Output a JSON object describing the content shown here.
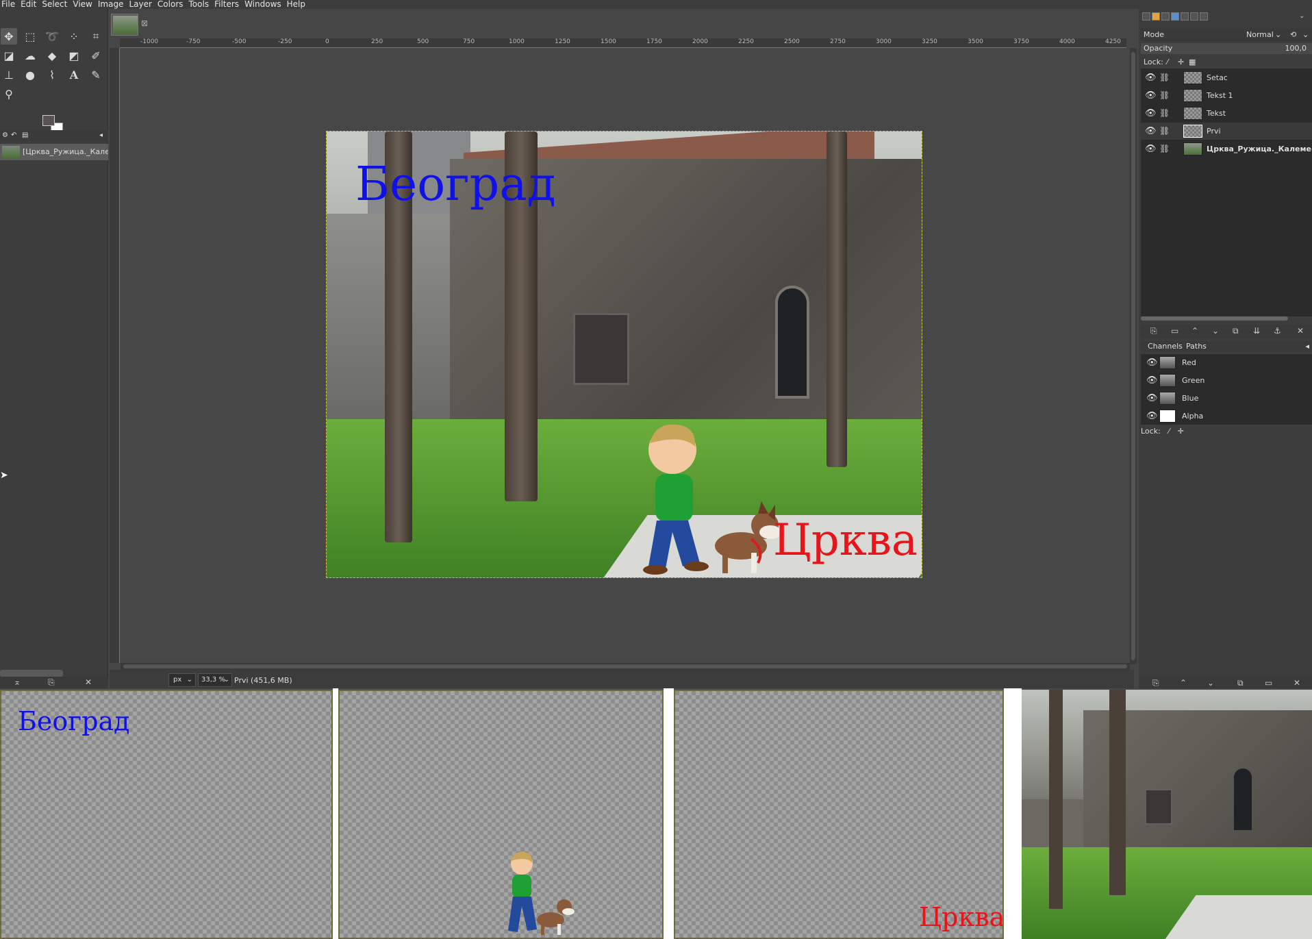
{
  "menu": [
    "File",
    "Edit",
    "Select",
    "View",
    "Image",
    "Layer",
    "Colors",
    "Tools",
    "Filters",
    "Windows",
    "Help"
  ],
  "colors": {
    "foreground": "#5b5353",
    "background": "#ffffff",
    "text_blue": "#1010e8",
    "text_red": "#e8141a"
  },
  "tools": [
    "move-icon",
    "rect-select-icon",
    "lasso-icon",
    "fuzzy-select-icon",
    "crop-icon",
    "transform-icon",
    "warp-icon",
    "bucket-fill-icon",
    "gradient-icon",
    "eraser-icon",
    "clone-icon",
    "smudge-icon",
    "paths-icon",
    "text-icon",
    "color-picker-icon",
    "zoom-icon"
  ],
  "image_list": {
    "entry": "[Црква_Ружица._Калем"
  },
  "rulers": {
    "h_ticks": [
      "-1000",
      "-750",
      "-500",
      "-250",
      "0",
      "250",
      "500",
      "750",
      "1000",
      "1250",
      "1500",
      "1750",
      "2000",
      "2250",
      "2500",
      "2750",
      "3000",
      "3250",
      "3500",
      "3750",
      "4000",
      "4250"
    ]
  },
  "canvas": {
    "text_top": "Београд",
    "text_bottom": "Црква"
  },
  "status": {
    "unit": "px",
    "zoom": "33,3 %",
    "text": "Prvi (451,6 MB)"
  },
  "layers_panel": {
    "mode_label": "Mode",
    "mode_value": "Normal",
    "opacity_label": "Opacity",
    "opacity_value": "100,0",
    "lock_label": "Lock:",
    "layers": [
      {
        "name": "Setac",
        "type": "transparent"
      },
      {
        "name": "Tekst 1",
        "type": "transparent"
      },
      {
        "name": "Tekst",
        "type": "transparent"
      },
      {
        "name": "Prvi",
        "type": "transparent",
        "active": true
      },
      {
        "name": "Црква_Ружица._Калемегд",
        "type": "photo"
      }
    ]
  },
  "channels_panel": {
    "tab_channels": "Channels",
    "tab_paths": "Paths",
    "channels": [
      "Red",
      "Green",
      "Blue",
      "Alpha"
    ],
    "lock_label": "Lock:"
  },
  "bottom_previews": {
    "p1_text": "Београд",
    "p3_text": "Црква"
  }
}
